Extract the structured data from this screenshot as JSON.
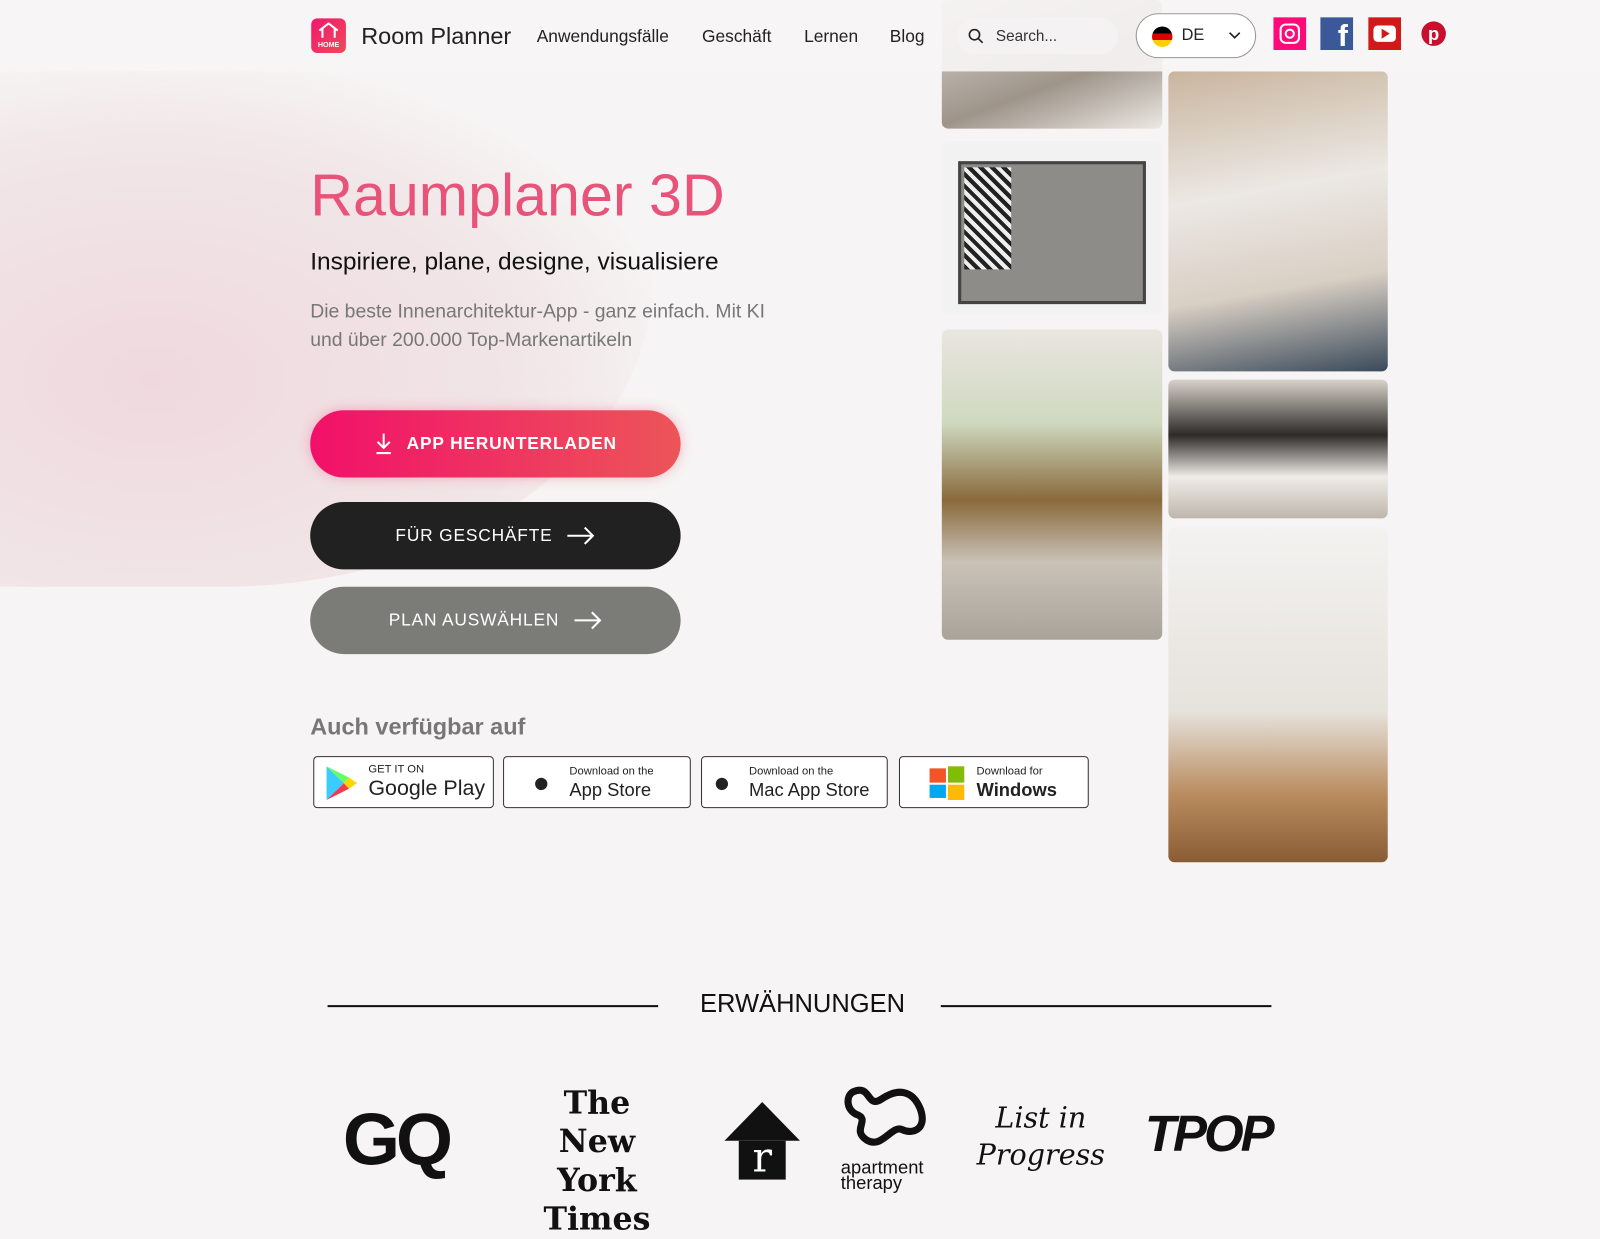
{
  "header": {
    "brand": "Room Planner",
    "logo_text": "HOME",
    "nav": [
      "Anwendungsfälle",
      "Geschäft",
      "Lernen",
      "Blog"
    ],
    "search_placeholder": "Search...",
    "language": "DE",
    "social": [
      "instagram-icon",
      "facebook-icon",
      "youtube-icon",
      "pinterest-icon"
    ]
  },
  "hero": {
    "title": "Raumplaner 3D",
    "subtitle": "Inspiriere, plane, designe, visualisiere",
    "description": "Die beste Innenarchitektur-App - ganz einfach. Mit KI und über 200.000 Top-Markenartikeln",
    "buttons": {
      "download": "APP HERUNTERLADEN",
      "business": "FÜR GESCHÄFTE",
      "plan": "PLAN AUSWÄHLEN"
    }
  },
  "stores": {
    "title": "Auch verfügbar auf",
    "items": [
      {
        "small": "GET IT ON",
        "large": "Google Play"
      },
      {
        "small": "Download on the",
        "large": "App Store"
      },
      {
        "small": "Download on the",
        "large": "Mac App Store"
      },
      {
        "small": "Download for",
        "large": "Windows"
      }
    ]
  },
  "mentions": {
    "title": "ERWÄHNUNGEN",
    "logos": [
      "GQ",
      "The New York Times",
      "r",
      "apartment therapy",
      "List in Progress",
      "TPOP"
    ]
  },
  "colors": {
    "accent": "#e8537a",
    "button_gradient_start": "#f2106a",
    "button_gradient_end": "#ec5558",
    "dark_button": "#212121",
    "grey_button": "#7b7b78"
  }
}
